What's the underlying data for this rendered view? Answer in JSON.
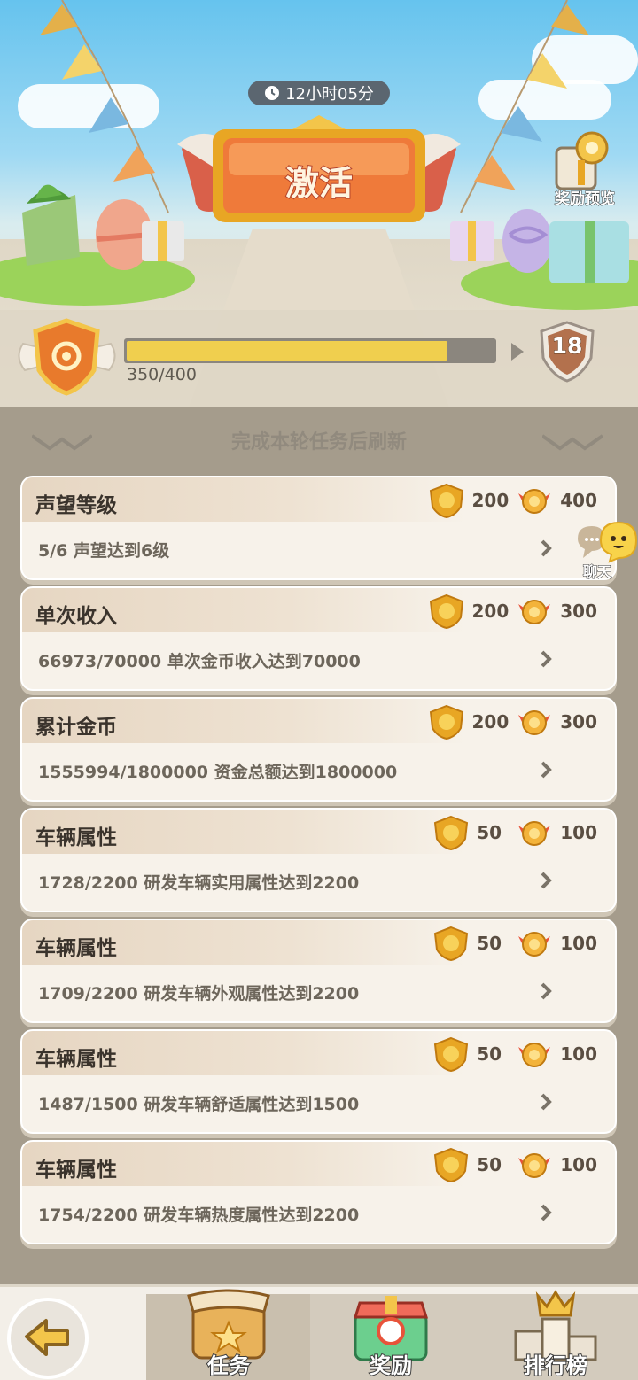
{
  "banner": {
    "timer": "12小时05分",
    "activate_label": "激活",
    "reward_preview_label": "奖励预览"
  },
  "progress": {
    "current": 350,
    "max": 400,
    "text": "350/400",
    "fraction": 0.875,
    "next_level": "18"
  },
  "list_header": "完成本轮任务后刷新",
  "chat_label": "聊天",
  "tasks": [
    {
      "title": "声望等级",
      "reward_a": "200",
      "reward_b": "400",
      "desc": "5/6  声望达到6级"
    },
    {
      "title": "单次收入",
      "reward_a": "200",
      "reward_b": "300",
      "desc": "66973/70000  单次金币收入达到70000"
    },
    {
      "title": "累计金币",
      "reward_a": "200",
      "reward_b": "300",
      "desc": "1555994/1800000  资金总额达到1800000"
    },
    {
      "title": "车辆属性",
      "reward_a": "50",
      "reward_b": "100",
      "desc": "1728/2200  研发车辆实用属性达到2200"
    },
    {
      "title": "车辆属性",
      "reward_a": "50",
      "reward_b": "100",
      "desc": "1709/2200  研发车辆外观属性达到2200"
    },
    {
      "title": "车辆属性",
      "reward_a": "50",
      "reward_b": "100",
      "desc": "1487/1500  研发车辆舒适属性达到1500"
    },
    {
      "title": "车辆属性",
      "reward_a": "50",
      "reward_b": "100",
      "desc": "1754/2200  研发车辆热度属性达到2200"
    }
  ],
  "bottom_nav": {
    "tab_task": "任务",
    "tab_reward": "奖励",
    "tab_rank": "排行榜"
  },
  "colors": {
    "progress_fill": "#f0cf4e",
    "activate_orange": "#ef7a3a",
    "gold": "#e8a624"
  }
}
